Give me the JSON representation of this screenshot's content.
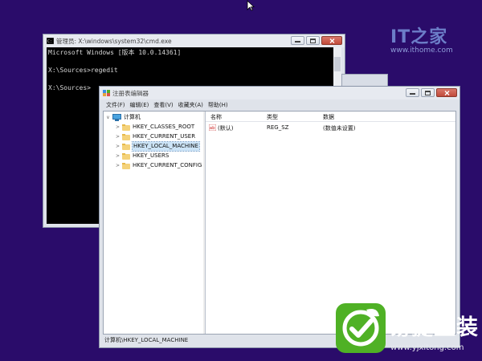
{
  "watermark_top": {
    "logo": "IT之家",
    "url": "www.ithome.com"
  },
  "cmd_window": {
    "title": "管理员: X:\\windows\\system32\\cmd.exe",
    "lines": [
      "Microsoft Windows [版本 10.0.14361]",
      "",
      "X:\\Sources>regedit",
      "",
      "X:\\Sources>"
    ]
  },
  "regedit_window": {
    "title": "注册表编辑器",
    "menu": [
      "文件(F)",
      "编辑(E)",
      "查看(V)",
      "收藏夹(A)",
      "帮助(H)"
    ],
    "tree": {
      "root": "计算机",
      "keys": [
        "HKEY_CLASSES_ROOT",
        "HKEY_CURRENT_USER",
        "HKEY_LOCAL_MACHINE",
        "HKEY_USERS",
        "HKEY_CURRENT_CONFIG"
      ],
      "selected_key": "HKEY_LOCAL_MACHINE"
    },
    "columns": [
      "名称",
      "类型",
      "数据"
    ],
    "rows": [
      {
        "name": "(默认)",
        "type": "REG_SZ",
        "data": "(数值未设置)"
      }
    ],
    "status": "计算机\\HKEY_LOCAL_MACHINE"
  },
  "watermark_bottom": {
    "name": "易捷重装",
    "url": "www.yjxitong.com"
  },
  "colors": {
    "desktop": "#2a0c6a",
    "console_bg": "#000000",
    "accent_green": "#4fb125",
    "selection": "#cce4f7"
  },
  "icons": [
    "cursor-icon",
    "console-icon",
    "minimize-icon",
    "maximize-icon",
    "close-icon",
    "computer-icon",
    "folder-icon",
    "string-value-icon",
    "check-leaf-icon",
    "regedit-icon"
  ]
}
